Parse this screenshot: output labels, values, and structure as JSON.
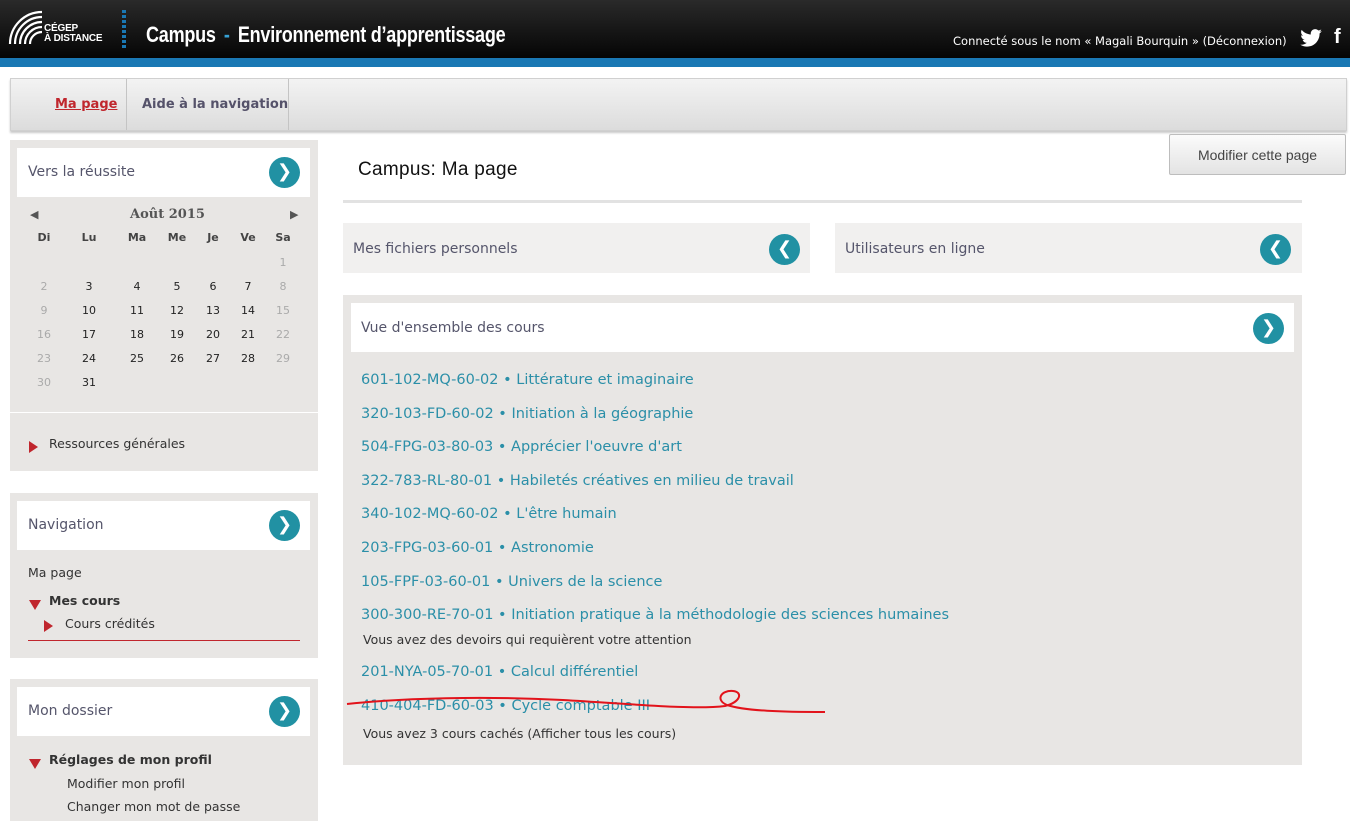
{
  "header": {
    "logo_line1": "CÉGEP",
    "logo_line2": "À DISTANCE",
    "title_campus": "Campus",
    "title_dash": "-",
    "title_env": "Environnement d’apprentissage",
    "connected_text": "Connecté sous le nom « Magali Bourquin » (Déconnexion)",
    "social_icons": [
      "twitter-icon",
      "facebook-icon"
    ],
    "facebook_glyph": "f",
    "accent_color": "#1a78b4"
  },
  "nav": {
    "items": [
      {
        "label": "Ma page",
        "active": true
      },
      {
        "label": "Aide à la navigation",
        "active": false
      }
    ]
  },
  "edit_button": "Modifier cette page",
  "main_title": "Campus: Ma page",
  "sidebar": {
    "reussite": {
      "title": "Vers la réussite",
      "calendar": {
        "prev": "◀",
        "next": "▶",
        "month": "Août 2015",
        "dow": [
          "Di",
          "Lu",
          "Ma",
          "Me",
          "Je",
          "Ve",
          "Sa"
        ],
        "weeks": [
          [
            "",
            "",
            "",
            "",
            "",
            "",
            "1"
          ],
          [
            "2",
            "3",
            "4",
            "5",
            "6",
            "7",
            "8"
          ],
          [
            "9",
            "10",
            "11",
            "12",
            "13",
            "14",
            "15"
          ],
          [
            "16",
            "17",
            "18",
            "19",
            "20",
            "21",
            "22"
          ],
          [
            "23",
            "24",
            "25",
            "26",
            "27",
            "28",
            "29"
          ],
          [
            "30",
            "31",
            "",
            "",
            "",
            "",
            ""
          ]
        ]
      },
      "resources_label": "Ressources générales"
    },
    "navigation": {
      "title": "Navigation",
      "ma_page": "Ma page",
      "mes_cours": "Mes cours",
      "cours_credites": "Cours crédités"
    },
    "dossier": {
      "title": "Mon dossier",
      "reglages": "Réglages de mon profil",
      "modifier_profil": "Modifier mon profil",
      "changer_mdp": "Changer mon mot de passe"
    }
  },
  "panels": {
    "fichiers": "Mes fichiers personnels",
    "utilisateurs": "Utilisateurs en ligne"
  },
  "courses": {
    "title": "Vue d'ensemble des cours",
    "list": [
      "601-102-MQ-60-02 • Littérature et imaginaire",
      "320-103-FD-60-02 • Initiation à la géographie",
      "504-FPG-03-80-03 • Apprécier l'oeuvre d'art",
      "322-783-RL-80-01 • Habiletés créatives en milieu de travail",
      "340-102-MQ-60-02 • L'être humain",
      "203-FPG-03-60-01 • Astronomie",
      "105-FPF-03-60-01 • Univers de la science",
      "300-300-RE-70-01 • Initiation pratique à la méthodologie des sciences humaines"
    ],
    "attention_note": "Vous avez des devoirs qui requièrent votre attention",
    "course_9": "201-NYA-05-70-01 • Calcul différentiel",
    "course_10": "410-404-FD-60-03 • Cycle comptable III",
    "hidden_note": "Vous avez 3 cours cachés (Afficher tous les cours)"
  },
  "icons": {
    "expand": "❯",
    "collapse": "❮"
  }
}
